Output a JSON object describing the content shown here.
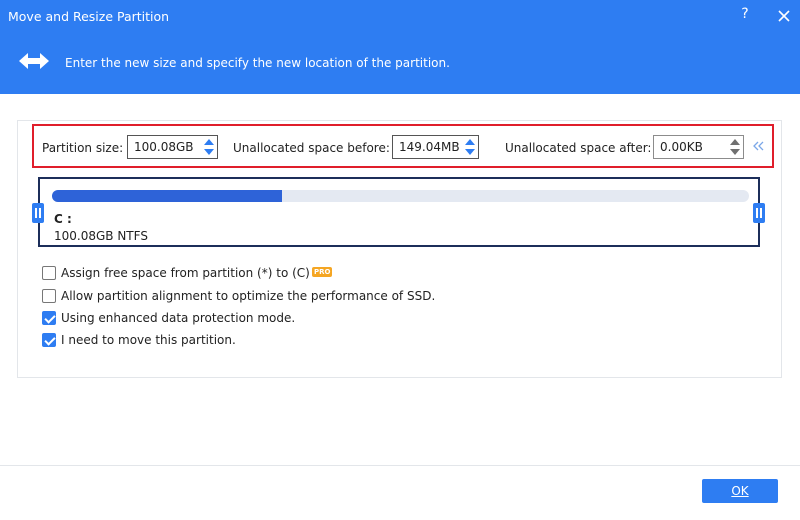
{
  "window": {
    "title": "Move and Resize Partition",
    "help_label": "?"
  },
  "banner": {
    "text": "Enter the new size and specify the new location of the partition.",
    "icon": "resize-arrows-icon"
  },
  "fields": {
    "partition_size_label": "Partition size:",
    "partition_size_value": "100.08GB",
    "unalloc_before_label": "Unallocated space before:",
    "unalloc_before_value": "149.04MB",
    "unalloc_after_label": "Unallocated space after:",
    "unalloc_after_value": "0.00KB"
  },
  "partition": {
    "label": "C :",
    "info": "100.08GB NTFS",
    "used_fraction": 0.33
  },
  "options": [
    {
      "label": "Assign free space from partition (*) to (C)",
      "checked": false,
      "badge": "PRO"
    },
    {
      "label": "Allow partition alignment to optimize the performance of SSD.",
      "checked": false
    },
    {
      "label": "Using enhanced data protection mode.",
      "checked": true
    },
    {
      "label": "I need to move this partition.",
      "checked": true
    }
  ],
  "footer": {
    "ok_label": "OK"
  },
  "colors": {
    "accent": "#2e7df2",
    "highlight": "#e01e2b",
    "bar_fill": "#2e63d8",
    "disk_border": "#1c2e5a"
  }
}
